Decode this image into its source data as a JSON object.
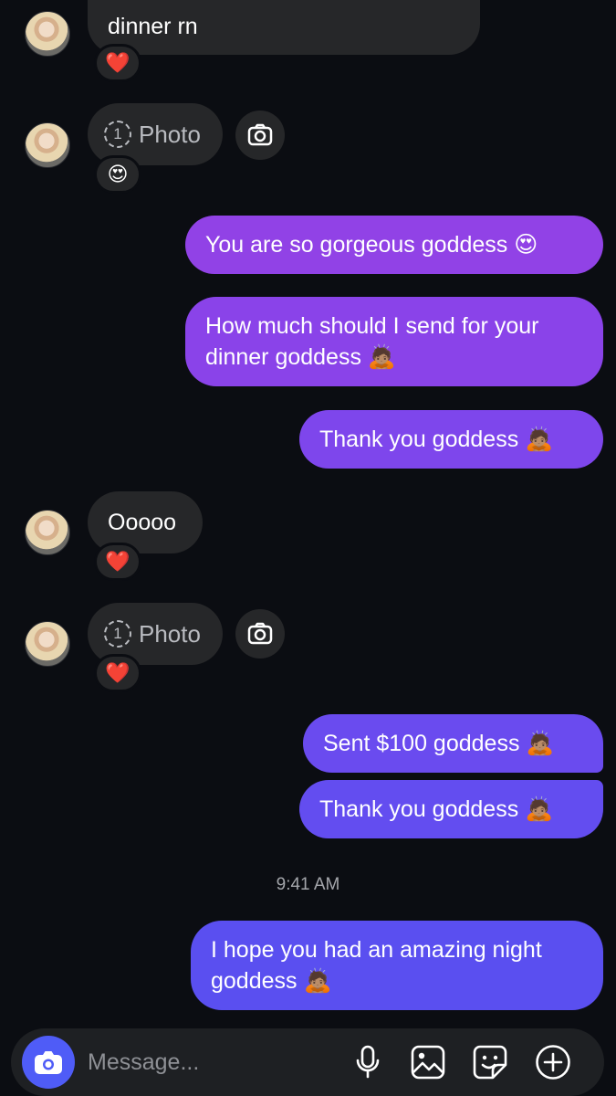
{
  "messages": {
    "m1": {
      "text": "dinner rn",
      "reaction": "❤️"
    },
    "m2": {
      "label": "Photo",
      "count": "1",
      "reaction": "😍"
    },
    "m3": {
      "text": "You are so gorgeous goddess 😍"
    },
    "m4": {
      "text": "How much should I send for your dinner goddess 🙇🏽"
    },
    "m5": {
      "text": "Thank you goddess 🙇🏽"
    },
    "m6": {
      "text": "Ooooo",
      "reaction": "❤️"
    },
    "m7": {
      "label": "Photo",
      "count": "1",
      "reaction": "❤️"
    },
    "m8": {
      "text": "Sent $100 goddess 🙇🏽"
    },
    "m9": {
      "text": "Thank you goddess 🙇🏽"
    },
    "m10": {
      "text": "I hope you had an amazing night goddess 🙇🏽"
    }
  },
  "timestamp": "9:41 AM",
  "composer": {
    "placeholder": "Message...",
    "icons": [
      "camera-icon",
      "microphone-icon",
      "gallery-icon",
      "sticker-icon",
      "plus-icon"
    ]
  },
  "colors": {
    "background": "#0b0d12",
    "incoming": "#262729",
    "outgoing_top": "#9142e6",
    "outgoing_bottom": "#5a4ff0",
    "accent": "#4f5cf7"
  }
}
